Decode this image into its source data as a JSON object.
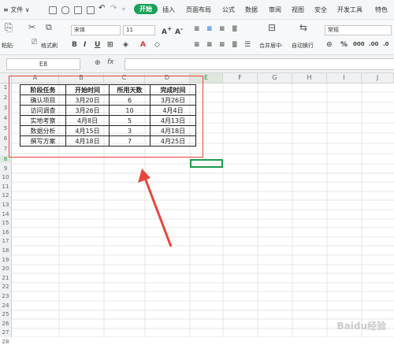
{
  "menu": {
    "file": "≡ 文件 ∨",
    "tabs": [
      "开始",
      "插入",
      "页面布局",
      "公式",
      "数据",
      "审阅",
      "视图",
      "安全",
      "开发工具",
      "特色"
    ]
  },
  "ribbon": {
    "paste": "粘贴·",
    "format_painter": "格式刷",
    "font_name": "宋体",
    "font_size": "11",
    "merge_center": "合并居中·",
    "wrap_text": "自动换行",
    "number_format": "常规"
  },
  "formula_bar": {
    "name_box": "E8",
    "fx": "fx",
    "formula": ""
  },
  "columns": [
    "A",
    "B",
    "C",
    "D",
    "E",
    "F",
    "G",
    "H",
    "I",
    "J"
  ],
  "rows": [
    "1",
    "2",
    "3",
    "4",
    "5",
    "6",
    "7",
    "8",
    "9",
    "10",
    "11",
    "12",
    "13",
    "14",
    "15",
    "16",
    "17",
    "18",
    "19",
    "20",
    "21",
    "22",
    "23",
    "24",
    "25",
    "26",
    "27",
    "28"
  ],
  "table": {
    "headers": [
      "阶段任务",
      "开始时间",
      "所用天数",
      "完成时间"
    ],
    "rows": [
      [
        "确认项目",
        "3月20日",
        "6",
        "3月26日"
      ],
      [
        "访问调查",
        "3月26日",
        "10",
        "4月4日"
      ],
      [
        "实地考察",
        "4月8日",
        "5",
        "4月13日"
      ],
      [
        "数据分析",
        "4月15日",
        "3",
        "4月18日"
      ],
      [
        "撰写方案",
        "4月18日",
        "7",
        "4月25日"
      ]
    ]
  },
  "annotation_color": "#e8453c",
  "selection_color": "#1d9b4f",
  "accent_color": "#18a058",
  "watermark": "Baidu经验"
}
